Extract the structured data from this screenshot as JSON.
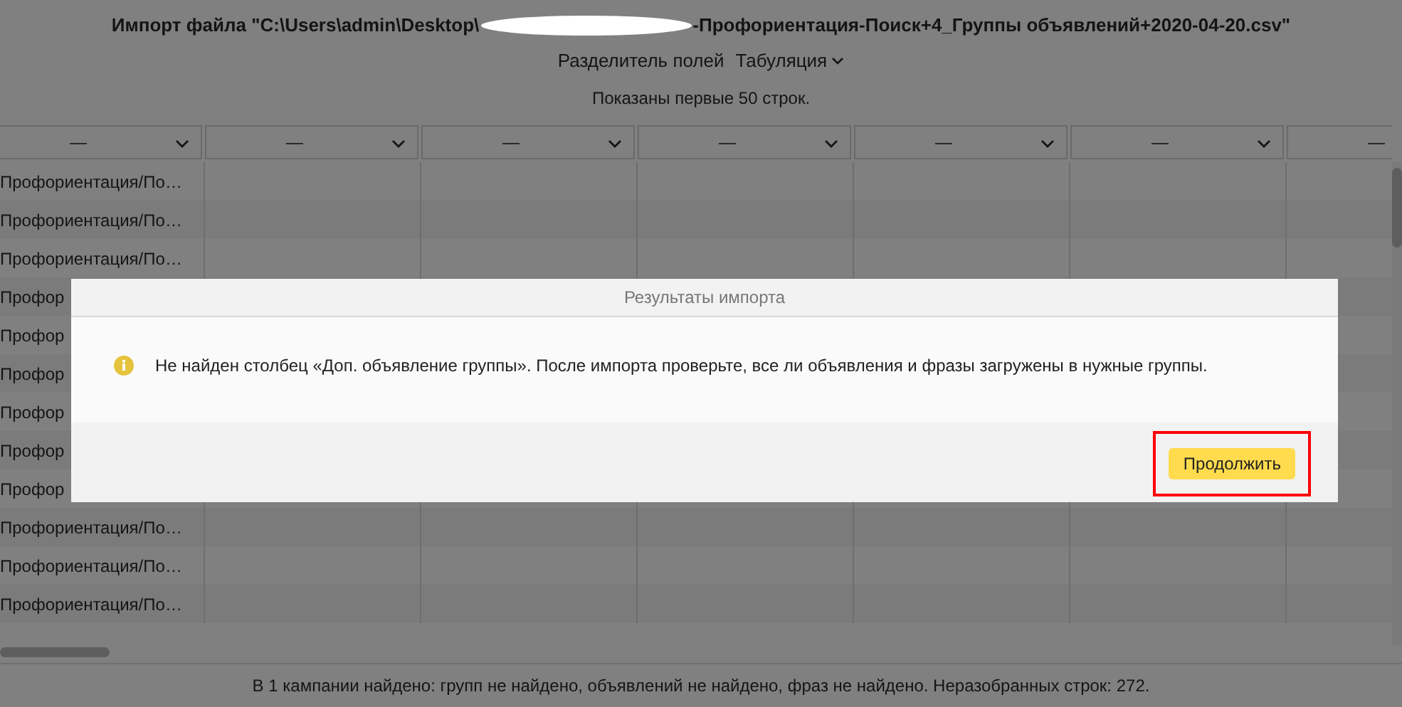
{
  "title": {
    "prefix": "Импорт файла \"C:\\Users\\admin\\Desktop\\",
    "suffix": "-Профориентация-Поиск+4_Группы объявлений+2020-04-20.csv\""
  },
  "separator": {
    "label": "Разделитель полей",
    "value": "Табуляция"
  },
  "notice": "Показаны первые 50 строк.",
  "columns": [
    {
      "label": "—"
    },
    {
      "label": "—"
    },
    {
      "label": "—"
    },
    {
      "label": "—"
    },
    {
      "label": "—"
    },
    {
      "label": "—"
    },
    {
      "label": "—"
    }
  ],
  "rows": [
    {
      "column_1": "Профориентация/По…"
    },
    {
      "column_1": "Профориентация/По…"
    },
    {
      "column_1": "Профориентация/По…"
    },
    {
      "column_1": "Профор"
    },
    {
      "column_1": "Профор"
    },
    {
      "column_1": "Профор"
    },
    {
      "column_1": "Профор"
    },
    {
      "column_1": "Профор"
    },
    {
      "column_1": "Профор"
    },
    {
      "column_1": "Профориентация/По…"
    },
    {
      "column_1": "Профориентация/По…"
    },
    {
      "column_1": "Профориентация/По…"
    }
  ],
  "dialog": {
    "title": "Результаты импорта",
    "message": "Не найден столбец «Доп. объявление группы». После импорта проверьте, все ли объявления и фразы загружены в нужные группы.",
    "button": {
      "label": "Продолжить",
      "highlighted": true
    }
  },
  "status_bar": "В 1 кампании найдено: групп не найдено, объявлений не найдено, фраз не найдено. Неразобранных строк: 272."
}
